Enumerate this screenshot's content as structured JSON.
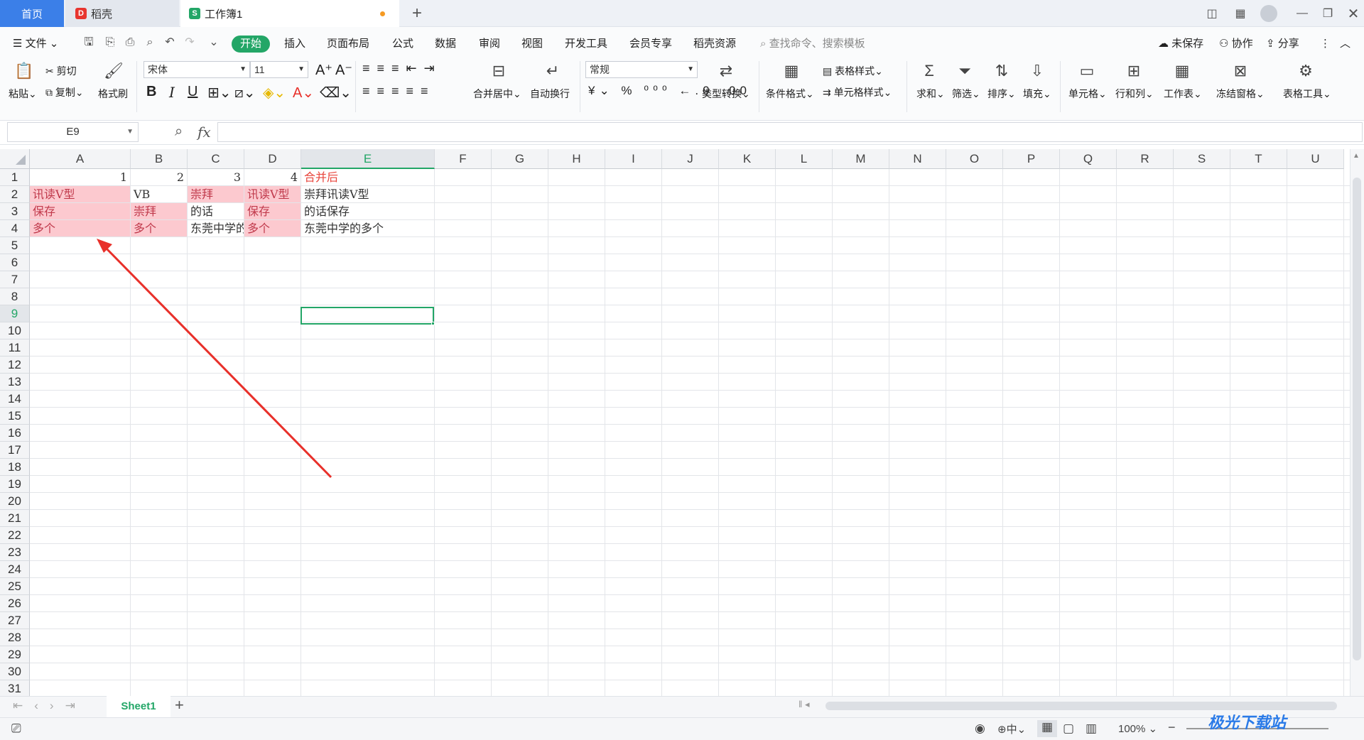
{
  "tabs": {
    "home": "首页",
    "daoke": "稻壳",
    "workbook": "工作簿1"
  },
  "menu": {
    "file": "文件",
    "start": "开始",
    "insert": "插入",
    "layout": "页面布局",
    "formula": "公式",
    "data": "数据",
    "review": "审阅",
    "view": "视图",
    "dev": "开发工具",
    "member": "会员专享",
    "resources": "稻壳资源",
    "search": "查找命令、搜索模板",
    "unsaved": "未保存",
    "collab": "协作",
    "share": "分享"
  },
  "ribbon": {
    "paste": "粘贴",
    "cut": "剪切",
    "copy": "复制",
    "format_painter": "格式刷",
    "font": "宋体",
    "size": "11",
    "merge": "合并居中",
    "wrap": "自动换行",
    "numfmt": "常规",
    "type_convert": "类型转换",
    "cond_format": "条件格式",
    "table_style": "表格样式",
    "cell_style": "单元格样式",
    "sum": "求和",
    "filter": "筛选",
    "sort": "排序",
    "fill": "填充",
    "cell": "单元格",
    "rowcol": "行和列",
    "sheet": "工作表",
    "freeze": "冻结窗格",
    "tools": "表格工具"
  },
  "formula_bar": {
    "name_box": "E9",
    "fx": "fx",
    "value": ""
  },
  "columns": [
    "A",
    "B",
    "C",
    "D",
    "E",
    "F",
    "G",
    "H",
    "I",
    "J",
    "K",
    "L",
    "M",
    "N",
    "O",
    "P",
    "Q",
    "R",
    "S",
    "T",
    "U"
  ],
  "rows": [
    "1",
    "2",
    "3",
    "4",
    "5",
    "6",
    "7",
    "8",
    "9",
    "10",
    "11",
    "12",
    "13",
    "14",
    "15",
    "16",
    "17",
    "18",
    "19",
    "20",
    "21",
    "22",
    "23",
    "24",
    "25",
    "26",
    "27",
    "28",
    "29",
    "30",
    "31"
  ],
  "cells": {
    "A1": "1",
    "B1": "2",
    "C1": "3",
    "D1": "4",
    "E1": "合并后",
    "A2": "讯读V型",
    "B2": "VB",
    "C2": "崇拜",
    "D2": "讯读V型",
    "E2": "崇拜讯读V型",
    "A3": "保存",
    "B3": "崇拜",
    "C3": "的话",
    "D3": "保存",
    "E3": "的话保存",
    "A4": "多个",
    "B4": "多个",
    "C4": "东莞中学的",
    "D4": "多个",
    "E4": "东莞中学的多个"
  },
  "sheet": {
    "name": "Sheet1"
  },
  "status": {
    "zoom": "100%",
    "ime": "中"
  },
  "colors": {
    "accent": "#23a667",
    "pink_fill": "#fcc9cf",
    "pink_text": "#c0394b",
    "red_text": "#e8453c",
    "arrow": "#e8302a",
    "tab_home": "#3b7fe8"
  },
  "watermark": "极光下载站"
}
